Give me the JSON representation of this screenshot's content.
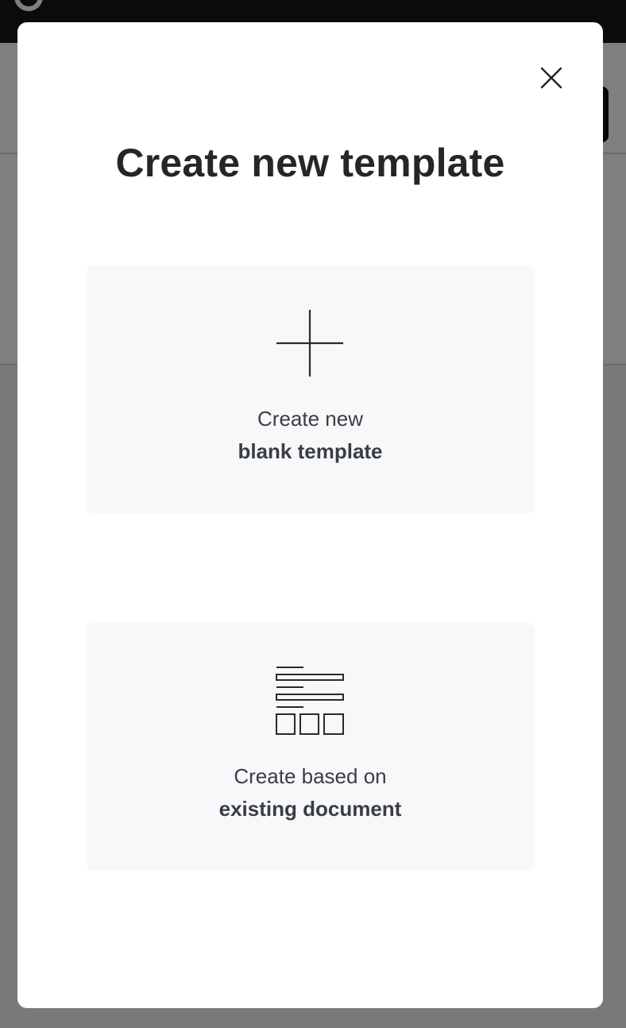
{
  "modal": {
    "title": "Create new template",
    "close_icon": "close-icon",
    "options": [
      {
        "icon": "plus-icon",
        "line1": "Create new",
        "line2": "blank template"
      },
      {
        "icon": "document-layout-icon",
        "line1": "Create based on",
        "line2": "existing document"
      }
    ]
  },
  "colors": {
    "overlay": "#808080",
    "modal_bg": "#ffffff",
    "card_bg": "#f7f8fa",
    "title": "#262626",
    "card_text": "#3a3d42",
    "topbar": "#161616"
  }
}
